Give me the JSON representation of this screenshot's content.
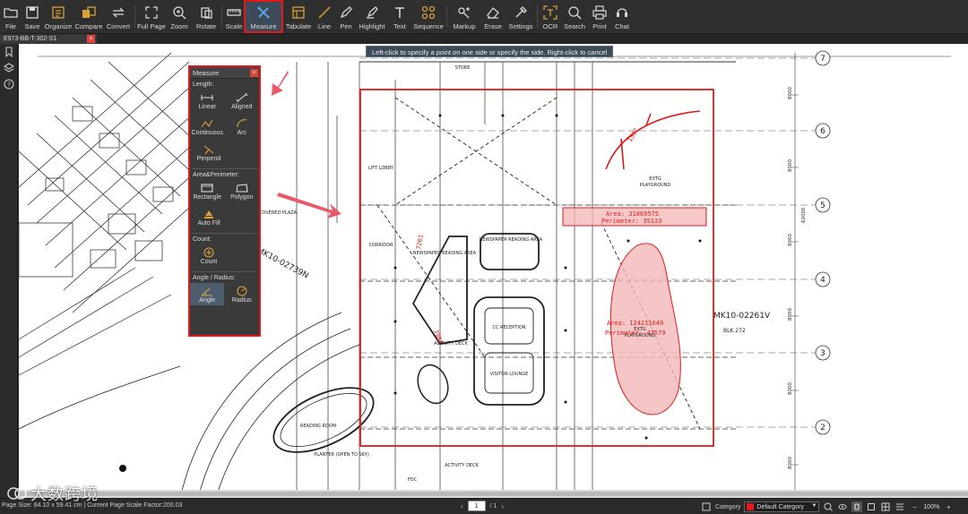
{
  "toolbar": {
    "items": [
      {
        "label": "File",
        "icon": "folder-icon"
      },
      {
        "label": "Save",
        "icon": "save-icon"
      },
      {
        "label": "Organize",
        "icon": "organize-icon"
      },
      {
        "label": "Compare",
        "icon": "compare-icon"
      },
      {
        "label": "Convert",
        "icon": "convert-icon"
      },
      {
        "label": "Full Page",
        "icon": "fullpage-icon"
      },
      {
        "label": "Zoom",
        "icon": "zoom-icon"
      },
      {
        "label": "Rotate",
        "icon": "rotate-icon"
      },
      {
        "label": "Scale",
        "icon": "scale-icon"
      },
      {
        "label": "Measure",
        "icon": "measure-icon"
      },
      {
        "label": "Tabulate",
        "icon": "tabulate-icon"
      },
      {
        "label": "Line",
        "icon": "line-icon"
      },
      {
        "label": "Pen",
        "icon": "pen-icon"
      },
      {
        "label": "Highlight",
        "icon": "highlight-icon"
      },
      {
        "label": "Text",
        "icon": "text-icon"
      },
      {
        "label": "Sequence",
        "icon": "sequence-icon"
      },
      {
        "label": "Markup",
        "icon": "markup-icon"
      },
      {
        "label": "Erase",
        "icon": "erase-icon"
      },
      {
        "label": "Settings",
        "icon": "settings-icon"
      },
      {
        "label": "OCR",
        "icon": "ocr-icon"
      },
      {
        "label": "Search",
        "icon": "search-icon"
      },
      {
        "label": "Print",
        "icon": "print-icon"
      },
      {
        "label": "Chat",
        "icon": "chat-icon"
      }
    ],
    "active": "Measure"
  },
  "tab": {
    "title": "E973-BB-T-302-S1",
    "close": "×"
  },
  "hint": "Left-click to specify a point on one side or specify the side. Right-click to cancel",
  "measure_panel": {
    "title": "Measure",
    "close": "×",
    "sections": {
      "length": "Length:",
      "area": "Area&Perimeter:",
      "count": "Count:",
      "angle": "Angle / Radius:"
    },
    "tools": {
      "linear": "Linear",
      "aligned": "Aligned",
      "continuous": "Continuous",
      "arc": "Arc",
      "perpend": "Perpend",
      "rectangle": "Rectangle",
      "polygon": "Polygon",
      "auto_fill": "Auto Fill",
      "count": "Count",
      "angle": "Angle",
      "radius": "Radius"
    },
    "selected": "Angle"
  },
  "drawing": {
    "grid_labels": [
      "7",
      "6",
      "5",
      "4",
      "3",
      "2"
    ],
    "dim_labels": [
      "8000",
      "8000",
      "8000",
      "8000",
      "8000",
      "62000",
      "8000",
      "8000"
    ],
    "area_label_1": "Area: 31869575",
    "perimeter_label_1": "Perimeter: 35133",
    "area_label_2": "Area: 124211649",
    "perimeter_label_2": "Perimeter: 47579",
    "playground_1": "EXTG\nPLAYGROUND",
    "playground_2": "EXTG\nPLAYGROUND",
    "blk_label": "MK10-02261V",
    "blk_sub": "BLK 272",
    "mk_left": "MK10-02739N",
    "dim_7201": "7201",
    "dim_3982": "3982",
    "dim_150": "150°",
    "rooms": [
      "NEWSPAPER READING AREA",
      "NEWSPAPER READING AREA",
      "CC RECEPTION",
      "VISITOR LOUNGE",
      "ACTIVITY DECK",
      "LIFT LOBBY",
      "COVERED PLAZA",
      "CORRIDOR",
      "STORE",
      "READING ROOM",
      "PLANTER (OPEN TO SKY)",
      "ACTIVITY DECK",
      "FDC"
    ]
  },
  "status": {
    "left": "Page Size: 84.10 x 59.41 cm | Current Page Scale Factor:200.03",
    "page_current": "1",
    "page_total": "/ 1",
    "category_label": "Category",
    "category_value": "Default Category",
    "zoom": "100%",
    "watermark": "大数跨境"
  },
  "colors": {
    "accent_red": "#e01a1a",
    "toolbar_bg": "#2f2f2f",
    "pink_fill": "#f4b6b6",
    "icon_gold": "#d9a13a"
  }
}
